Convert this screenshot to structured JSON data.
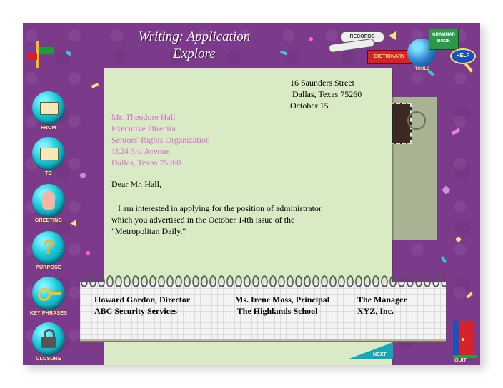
{
  "header": {
    "title_line1": "Writing: Application",
    "title_line2": "Explore"
  },
  "tools": {
    "records": "RECORDS",
    "dictionary": "DICTIONARY",
    "globe": "TOOLS",
    "grammar_book": "GRAMMAR BOOK",
    "help": "HELP"
  },
  "nav": [
    {
      "label": "FROM",
      "icon": "envelope-from-icon"
    },
    {
      "label": "TO",
      "icon": "envelope-to-icon"
    },
    {
      "label": "GREETING",
      "icon": "hand-icon"
    },
    {
      "label": "PURPOSE",
      "icon": "question-mark-icon"
    },
    {
      "label": "KEY PHRASES",
      "icon": "key-icon"
    },
    {
      "label": "CLOSURE",
      "icon": "padlock-icon"
    }
  ],
  "letter": {
    "sender_address": [
      "16 Saunders Street",
      " Dallas, Texas 75260",
      "October 15"
    ],
    "recipient": [
      "Mr. Theodore Hall",
      "Executive Director",
      "Seniors' Rights Organization",
      "1824 3rd Avenue",
      "Dallas, Texas 75260"
    ],
    "salutation": "Dear Mr. Hall,",
    "body": [
      "   I am interested in applying for the position of administrator",
      "which you advertised in the October 14th issue of the",
      "\"Metropolitan Daily.\""
    ]
  },
  "notepad": {
    "addresses": [
      {
        "line1": "Howard Gordon, Director",
        "line2": "ABC Security Services"
      },
      {
        "line1": "Ms. Irene Moss, Principal",
        "line2": " The Highlands School"
      },
      {
        "line1": "The Manager",
        "line2": "XYZ, Inc."
      }
    ]
  },
  "buttons": {
    "next": "NEXT",
    "quit": "QUIT"
  },
  "colors": {
    "background": "#7c3a8b",
    "paper": "#d9ebc4",
    "recipient_text": "#d96dd3",
    "nav_label": "#ffe98a",
    "nav_button": "#18c6d8"
  }
}
